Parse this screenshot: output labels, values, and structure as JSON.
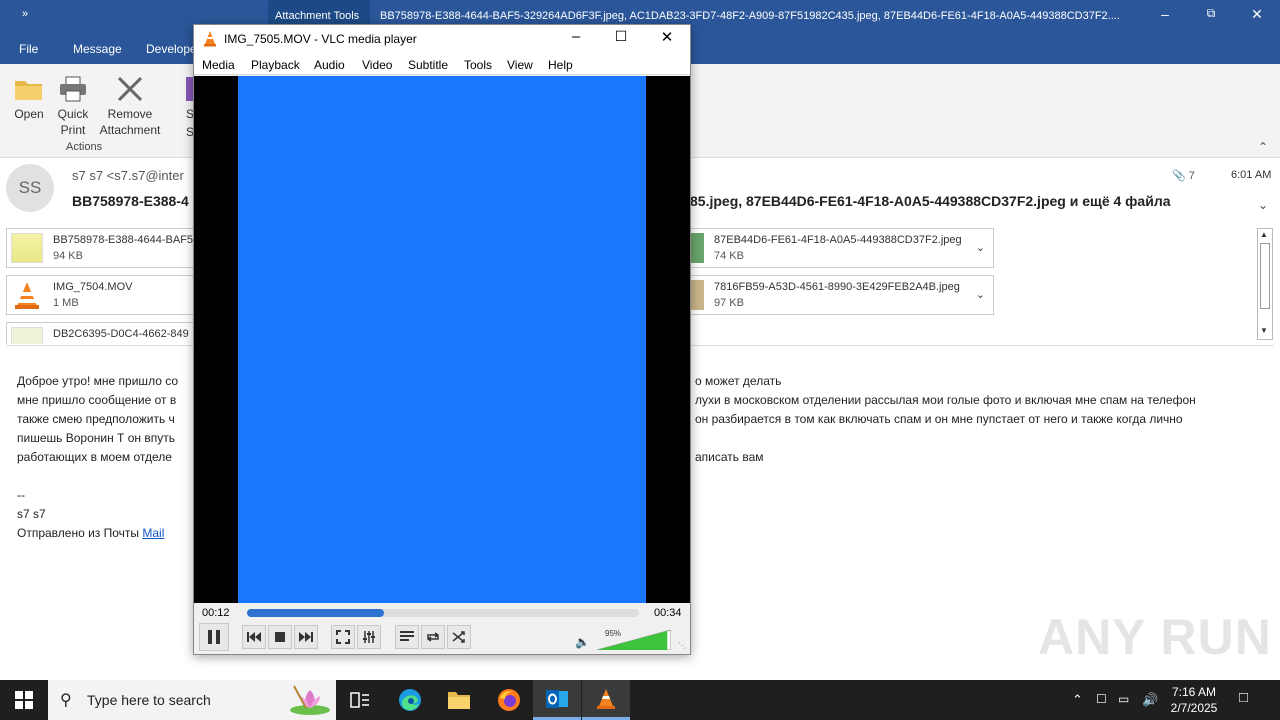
{
  "outlook": {
    "quick_access": "»",
    "context_tab": "Attachment Tools",
    "title_text": "BB758978-E388-4644-BAF5-329264AD6F3F.jpeg, AC1DAB23-3FD7-48F2-A909-87F51982C435.jpeg, 87EB44D6-FE61-4F18-A0A5-449388CD37F2....",
    "tabs": [
      "File",
      "Message",
      "Develope"
    ],
    "ribbon": {
      "open": "Open",
      "quick_print": [
        "Quick",
        "Print"
      ],
      "remove_attachment": [
        "Remove",
        "Attachment"
      ],
      "partial_1": "S",
      "partial_2": "S",
      "group_actions": "Actions"
    },
    "message": {
      "avatar_initials": "SS",
      "from": "s7 s7 <s7.s7@inter",
      "subject_left": "BB758978-E388-4",
      "subject_right": "85.jpeg, 87EB44D6-FE61-4F18-A0A5-449388CD37F2.jpeg и ещё 4 файла",
      "attachment_count": "7",
      "time": "6:01 AM"
    },
    "attachments": [
      {
        "name": "BB758978-E388-4644-BAF5",
        "size": "94 KB"
      },
      {
        "name": "IMG_7504.MOV",
        "size": "1 MB"
      },
      {
        "name": "DB2C6395-D0C4-4662-849",
        "size": ""
      },
      {
        "name": "87EB44D6-FE61-4F18-A0A5-449388CD37F2.jpeg",
        "size": "74 KB"
      },
      {
        "name": "7816FB59-A53D-4561-8990-3E429FEB2A4B.jpeg",
        "size": "97 KB"
      }
    ],
    "body": {
      "l1": "Доброе утро! мне пришло со",
      "l1r": "о может делать",
      "l2": "мне пришло сообщение от в",
      "l2r": "лухи в московском отделении рассылая мои голые фото и включая мне спам на телефон",
      "l3": "также смею предположить ч",
      "l3r": "он разбирается в том как включать спам и он мне пупстает от него и также когда лично",
      "l4": "пишешь Воронин Т он впуть",
      "l5": "работающих в моем отделе",
      "l5r": "аписать вам",
      "sig_dash": "--",
      "sig_name": "s7 s7",
      "sig_sent": "Отправлено из Почты ",
      "sig_link": "Mail"
    }
  },
  "vlc": {
    "title": "IMG_7505.MOV - VLC media player",
    "menu": [
      "Media",
      "Playback",
      "Audio",
      "Video",
      "Subtitle",
      "Tools",
      "View",
      "Help"
    ],
    "elapsed": "00:12",
    "total": "00:34",
    "progress": 0.35,
    "volume": "95%",
    "volume_level": 0.95,
    "video_color": "#1877fe"
  },
  "taskbar": {
    "search_placeholder": "Type here to search",
    "time": "7:16 AM",
    "date": "2/7/2025"
  },
  "watermark": "ANY RUN"
}
